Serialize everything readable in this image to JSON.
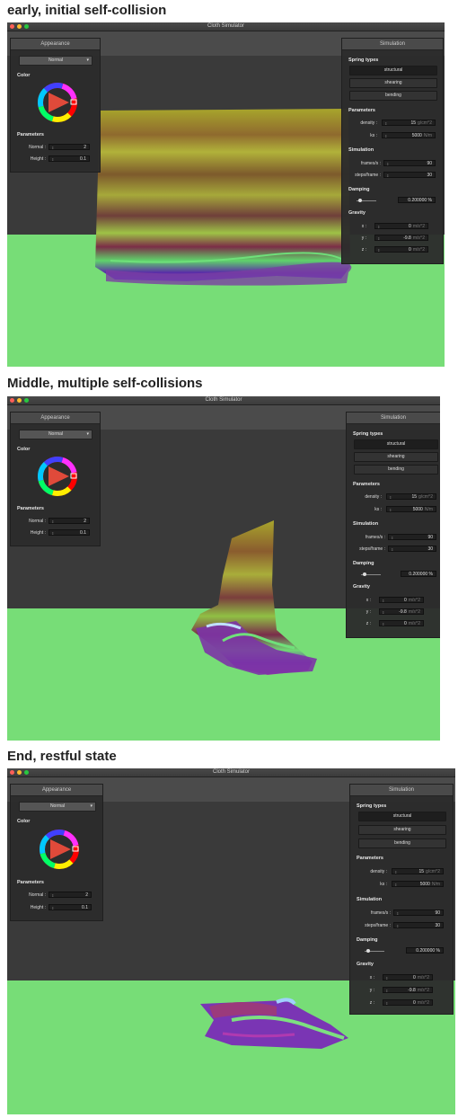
{
  "panels": [
    {
      "caption": "early, initial self-collision",
      "window_title": "Cloth Simulator",
      "appearance": {
        "title": "Appearance",
        "shader": "Normal",
        "color_label": "Color",
        "params_label": "Parameters",
        "normal_label": "Normal :",
        "normal_value": "2",
        "height_label": "Height :",
        "height_value": "0.1"
      },
      "simulation": {
        "title": "Simulation",
        "spring_types_label": "Spring types",
        "structural": "structural",
        "shearing": "shearing",
        "bending": "bending",
        "params_label": "Parameters",
        "density_label": "density :",
        "density_value": "15",
        "density_unit": "g/cm^2",
        "ks_label": "ks :",
        "ks_value": "5000",
        "ks_unit": "N/m",
        "sim_label": "Simulation",
        "fps_label": "frames/s :",
        "fps_value": "90",
        "steps_label": "steps/frame :",
        "steps_value": "30",
        "damping_label": "Damping",
        "damping_value": "0.200000 %",
        "gravity_label": "Gravity",
        "gx_label": "x :",
        "gx_value": "0",
        "gy_label": "y :",
        "gy_value": "-9.8",
        "gz_label": "z :",
        "gz_value": "0",
        "g_unit": "m/s^2"
      }
    },
    {
      "caption": "Middle, multiple self-collisions",
      "window_title": "Cloth Simulator",
      "appearance": {
        "title": "Appearance",
        "shader": "Normal",
        "color_label": "Color",
        "params_label": "Parameters",
        "normal_label": "Normal :",
        "normal_value": "2",
        "height_label": "Height :",
        "height_value": "0.1"
      },
      "simulation": {
        "title": "Simulation",
        "spring_types_label": "Spring types",
        "structural": "structural",
        "shearing": "shearing",
        "bending": "bending",
        "params_label": "Parameters",
        "density_label": "density :",
        "density_value": "15",
        "density_unit": "g/cm^2",
        "ks_label": "ks :",
        "ks_value": "5000",
        "ks_unit": "N/m",
        "sim_label": "Simulation",
        "fps_label": "frames/s :",
        "fps_value": "90",
        "steps_label": "steps/frame :",
        "steps_value": "30",
        "damping_label": "Damping",
        "damping_value": "0.200000 %",
        "gravity_label": "Gravity",
        "gx_label": "x :",
        "gx_value": "0",
        "gy_label": "y :",
        "gy_value": "-9.8",
        "gz_label": "z :",
        "gz_value": "0",
        "g_unit": "m/s^2"
      }
    },
    {
      "caption": "End, restful state",
      "window_title": "Cloth Simulator",
      "appearance": {
        "title": "Appearance",
        "shader": "Normal",
        "color_label": "Color",
        "params_label": "Parameters",
        "normal_label": "Normal :",
        "normal_value": "2",
        "height_label": "Height :",
        "height_value": "0.1"
      },
      "simulation": {
        "title": "Simulation",
        "spring_types_label": "Spring types",
        "structural": "structural",
        "shearing": "shearing",
        "bending": "bending",
        "params_label": "Parameters",
        "density_label": "density :",
        "density_value": "15",
        "density_unit": "g/cm^2",
        "ks_label": "ks :",
        "ks_value": "5000",
        "ks_unit": "N/m",
        "sim_label": "Simulation",
        "fps_label": "frames/s :",
        "fps_value": "90",
        "steps_label": "steps/frame :",
        "steps_value": "30",
        "damping_label": "Damping",
        "damping_value": "0.200000 %",
        "gravity_label": "Gravity",
        "gx_label": "x :",
        "gx_value": "0",
        "gy_label": "y :",
        "gy_value": "-9.8",
        "gz_label": "z :",
        "gz_value": "0",
        "g_unit": "m/s^2"
      }
    }
  ],
  "colors": {
    "floor": "#77dd77",
    "wall": "#3a3a3a",
    "panel_bg": "#2c2c2c"
  },
  "icons": [
    "color-wheel-icon",
    "spinner-icon",
    "dropdown-chevron-icon",
    "slider-knob-icon"
  ]
}
